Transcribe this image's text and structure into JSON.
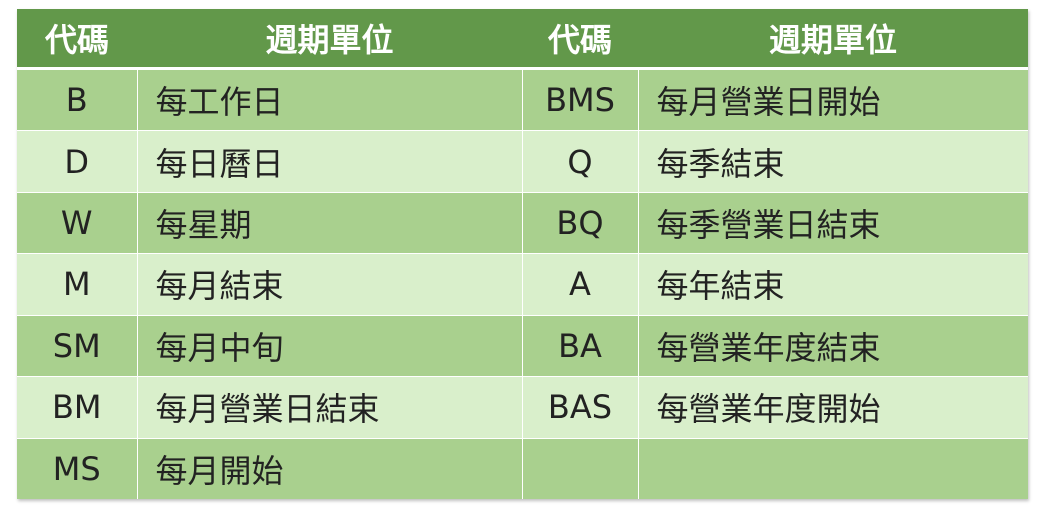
{
  "headers": [
    "代碼",
    "週期單位",
    "代碼",
    "週期單位"
  ],
  "rows": [
    [
      "B",
      "每工作日",
      "BMS",
      "每月營業日開始"
    ],
    [
      "D",
      "每日曆日",
      "Q",
      "每季結束"
    ],
    [
      "W",
      "每星期",
      "BQ",
      "每季營業日結束"
    ],
    [
      "M",
      "每月結束",
      "A",
      "每年結束"
    ],
    [
      "SM",
      "每月中旬",
      "BA",
      "每營業年度結束"
    ],
    [
      "BM",
      "每月營業日結束",
      "BAS",
      "每營業年度開始"
    ],
    [
      "MS",
      "每月開始",
      "",
      ""
    ]
  ],
  "colors": {
    "header_bg": "#62984a",
    "row_dark": "#a9d08e",
    "row_light": "#d9efcb"
  }
}
